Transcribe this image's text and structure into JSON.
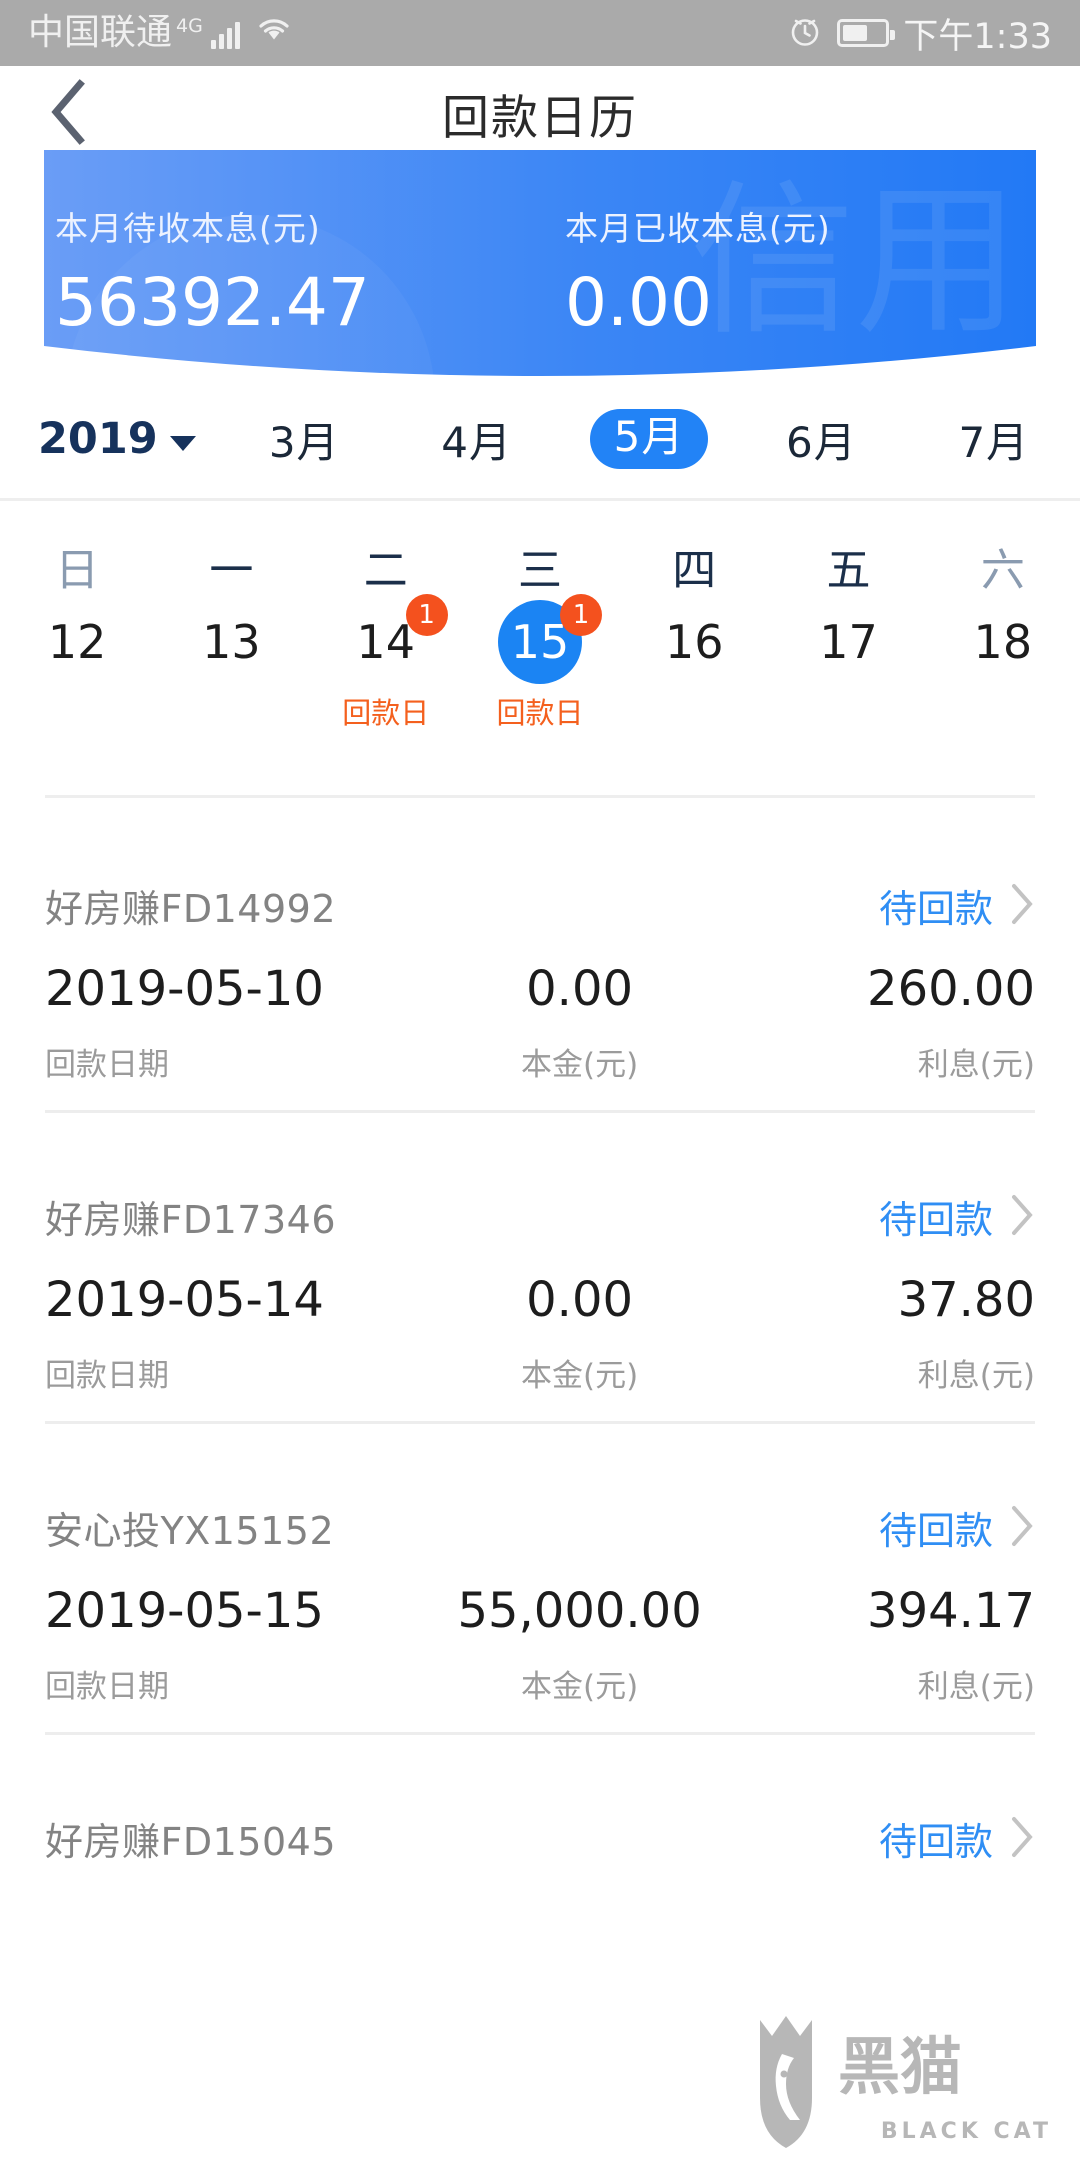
{
  "statusbar": {
    "carrier": "中国联通",
    "network": "4G",
    "signal_icon": "signal-bars-icon",
    "wifi_icon": "wifi-icon",
    "alarm_icon": "alarm-clock-icon",
    "battery_icon": "battery-icon",
    "battery_level": 60,
    "time": "下午1:33"
  },
  "navbar": {
    "back_icon": "back-chevron-icon",
    "title": "回款日历"
  },
  "summary": {
    "pending": {
      "label": "本月待收本息(元)",
      "value": "56392.47"
    },
    "received": {
      "label": "本月已收本息(元)",
      "value": "0.00"
    },
    "gradient_from": "#6a9df6",
    "gradient_to": "#2279f5"
  },
  "monthbar": {
    "year": "2019",
    "caret_icon": "chevron-down-icon",
    "months": [
      "3月",
      "4月",
      "5月",
      "6月",
      "7月"
    ],
    "selected_month": "5月",
    "accent": "#2283f6"
  },
  "calendar": {
    "weekdays": [
      "日",
      "一",
      "二",
      "三",
      "四",
      "五",
      "六"
    ],
    "days": [
      {
        "num": "12",
        "badge": "",
        "tag": "",
        "selected": false
      },
      {
        "num": "13",
        "badge": "",
        "tag": "",
        "selected": false
      },
      {
        "num": "14",
        "badge": "1",
        "tag": "回款日",
        "selected": false
      },
      {
        "num": "15",
        "badge": "1",
        "tag": "回款日",
        "selected": true
      },
      {
        "num": "16",
        "badge": "",
        "tag": "",
        "selected": false
      },
      {
        "num": "17",
        "badge": "",
        "tag": "",
        "selected": false
      },
      {
        "num": "18",
        "badge": "",
        "tag": "",
        "selected": false
      }
    ],
    "badge_color": "#f4511e",
    "selected_color": "#1b84f3"
  },
  "list": {
    "labels": {
      "date": "回款日期",
      "principal": "本金(元)",
      "interest": "利息(元)"
    },
    "chevron_icon": "chevron-right-icon",
    "items": [
      {
        "name": "好房赚FD14992",
        "status": "待回款",
        "date": "2019-05-10",
        "principal": "0.00",
        "interest": "260.00"
      },
      {
        "name": "好房赚FD17346",
        "status": "待回款",
        "date": "2019-05-14",
        "principal": "0.00",
        "interest": "37.80"
      },
      {
        "name": "安心投YX15152",
        "status": "待回款",
        "date": "2019-05-15",
        "principal": "55,000.00",
        "interest": "394.17"
      },
      {
        "name": "好房赚FD15045",
        "status": "待回款",
        "date": "",
        "principal": "",
        "interest": ""
      }
    ]
  },
  "watermark": {
    "logo_icon": "black-cat-logo-icon",
    "text": "BLACK CAT",
    "cn_text": "黑猫"
  }
}
